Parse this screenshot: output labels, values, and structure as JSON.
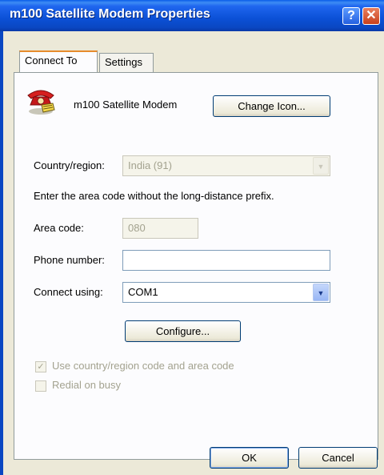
{
  "window": {
    "title": "m100 Satellite Modem Properties"
  },
  "tabs": [
    {
      "label": "Connect To",
      "active": true
    },
    {
      "label": "Settings",
      "active": false
    }
  ],
  "device": {
    "icon": "modem-phone-icon",
    "name": "m100 Satellite Modem",
    "change_icon_label": "Change Icon..."
  },
  "country": {
    "label": "Country/region:",
    "value": "India (91)"
  },
  "area_hint": "Enter the area code without the long-distance prefix.",
  "area_code": {
    "label": "Area code:",
    "value": "080"
  },
  "phone_number": {
    "label": "Phone number:",
    "value": ""
  },
  "connect_using": {
    "label": "Connect using:",
    "value": "COM1"
  },
  "configure_label": "Configure...",
  "options": {
    "use_country_code": {
      "label": "Use country/region code and area code",
      "checked": true
    },
    "redial_on_busy": {
      "label": "Redial on busy",
      "checked": false
    }
  },
  "footer": {
    "ok_label": "OK",
    "cancel_label": "Cancel"
  },
  "colors": {
    "titlebar": "#0b50d6",
    "client": "#ece9d8",
    "panel": "#fcfcfe",
    "close_button": "#c9401c",
    "tab_accent": "#e68b2c"
  }
}
